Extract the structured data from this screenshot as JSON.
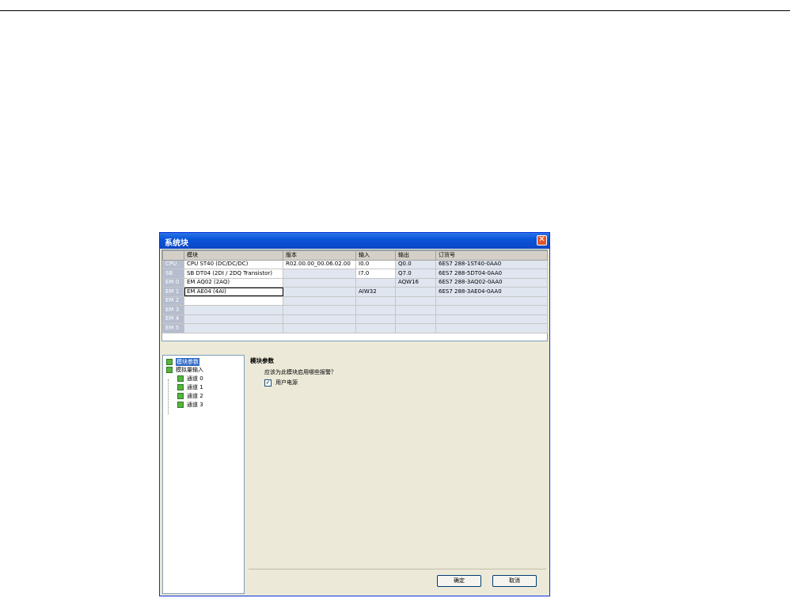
{
  "dialog": {
    "title": "系统块",
    "close_symbol": "✕",
    "colors": {
      "titlebar": "#0a55d8",
      "row_header": "#b5bdce",
      "close": "#e2572c",
      "tree_icon": "#58b340"
    }
  },
  "grid": {
    "columns": [
      "",
      "模块",
      "版本",
      "输入",
      "输出",
      "订货号"
    ],
    "rows": [
      {
        "id": "CPU",
        "module": "CPU ST40 (DC/DC/DC)",
        "version": "R02.00.00_00.06.02.00",
        "input": "I0.0",
        "output": "Q0.0",
        "order": "6ES7 288-1ST40-0AA0"
      },
      {
        "id": "SB",
        "module": "SB DT04 (2DI / 2DQ Transistor)",
        "version": "",
        "input": "I7.0",
        "output": "Q7.0",
        "order": "6ES7 288-5DT04-0AA0"
      },
      {
        "id": "EM 0",
        "module": "EM AQ02 (2AQ)",
        "version": "",
        "input": "",
        "output": "AQW16",
        "order": "6ES7 288-3AQ02-0AA0"
      },
      {
        "id": "EM 1",
        "module": "EM AE04 (4AI)",
        "version": "",
        "input": "AIW32",
        "output": "",
        "order": "6ES7 288-3AE04-0AA0"
      },
      {
        "id": "EM 2",
        "module": "",
        "version": "",
        "input": "",
        "output": "",
        "order": ""
      },
      {
        "id": "EM 3",
        "module": "",
        "version": "",
        "input": "",
        "output": "",
        "order": ""
      },
      {
        "id": "EM 4",
        "module": "",
        "version": "",
        "input": "",
        "output": "",
        "order": ""
      },
      {
        "id": "EM 5",
        "module": "",
        "version": "",
        "input": "",
        "output": "",
        "order": ""
      }
    ]
  },
  "tree": {
    "items": [
      {
        "label": "模块参数",
        "icon": "module-icon"
      },
      {
        "label": "模拟量输入",
        "icon": "folder-icon"
      },
      {
        "label": "通道 0",
        "icon": "channel-icon"
      },
      {
        "label": "通道 1",
        "icon": "channel-icon"
      },
      {
        "label": "通道 2",
        "icon": "channel-icon"
      },
      {
        "label": "通道 3",
        "icon": "channel-icon"
      }
    ]
  },
  "content": {
    "title": "模块参数",
    "question": "应该为此模块启用哪些报警？",
    "checkbox_label": "用户电源",
    "checkbox_mark": "✓"
  },
  "buttons": {
    "ok": "确定",
    "cancel": "取消"
  }
}
